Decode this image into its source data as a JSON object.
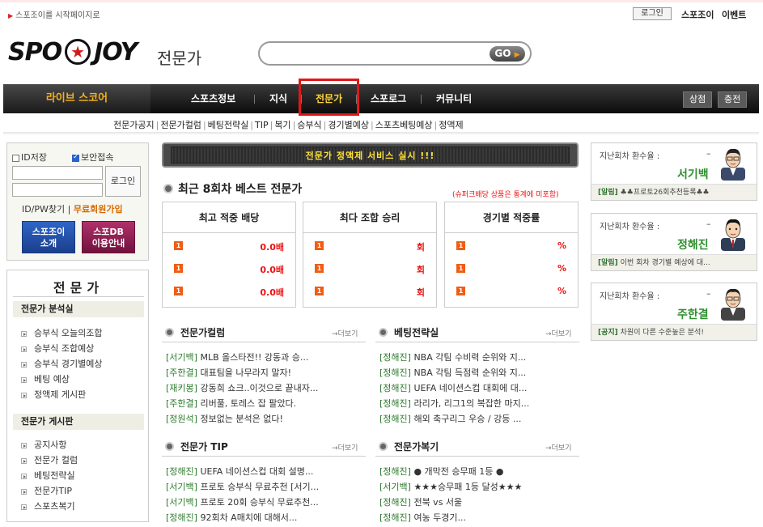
{
  "top": {
    "startpage": "스포조이를 시작페이지로",
    "login": "로그인",
    "spojoy": "스포조이",
    "event": "이벤트"
  },
  "logo": {
    "left": "SPO",
    "right": "JOY",
    "sub": "전문가"
  },
  "search": {
    "value": "",
    "go": "GO"
  },
  "nav": {
    "live": "라이브 스코어",
    "items": [
      "스포츠정보",
      "지식",
      "전문가",
      "스포로그",
      "커뮤니티"
    ],
    "shop": "상점",
    "charge": "충전"
  },
  "subnav": [
    "전문가공지",
    "전문가컬럼",
    "베팅전략실",
    "TIP",
    "복기",
    "승부식",
    "경기별예상",
    "스포츠베팅예상",
    "정액제"
  ],
  "login": {
    "save_id": "ID저장",
    "secure": "보안접속",
    "button": "로그인",
    "find": "ID/PW찾기",
    "register": "무료회원가입",
    "btn1": [
      "스포조이",
      "소개"
    ],
    "btn2": [
      "스포DB",
      "이용안내"
    ]
  },
  "leftmenu": {
    "title": "전문가",
    "sec1": "전문가 분석실",
    "items1": [
      "승부식 오늘의조합",
      "승부식 조합예상",
      "승부식 경기별예상",
      "베팅 예상",
      "정액제 게시판"
    ],
    "sec2": "전문가 게시판",
    "items2": [
      "공지사항",
      "전문가 컬럼",
      "베팅전략실",
      "전문가TIP",
      "스포츠복기"
    ]
  },
  "banner": "전문가 정액제 서비스 실시 !!!",
  "best": {
    "title": "최근 8회차 베스트 전문가",
    "note": "(슈퍼크배당 상품은 통계에 미포함)",
    "panels": [
      {
        "title": "최고 적중 배당",
        "rows": [
          "0.0배",
          "0.0배",
          "0.0배"
        ]
      },
      {
        "title": "최다 조합 승리",
        "rows": [
          "회",
          "회",
          "회"
        ]
      },
      {
        "title": "경기별 적중률",
        "rows": [
          "%",
          "%",
          "%"
        ]
      }
    ],
    "rank_label": "1"
  },
  "sections": {
    "more": "→더보기",
    "column": {
      "title": "전문가컬럼",
      "items": [
        {
          "tag": "[서기백]",
          "text": " MLB 올스타전!! 강동과 승..."
        },
        {
          "tag": "[주한결]",
          "text": " 대표팀을 나무라지 말자!"
        },
        {
          "tag": "[재키봉]",
          "text": " 강동희 쇼크..이것으로 끝내자..."
        },
        {
          "tag": "[주한결]",
          "text": " 리버풀, 토레스 잡 팔았다."
        },
        {
          "tag": "[정원석]",
          "text": " 정보없는 분석은 없다!"
        }
      ]
    },
    "strategy": {
      "title": "베팅전략실",
      "items": [
        {
          "tag": "[정해진]",
          "text": " NBA 각팀 수비력 순위와 지..."
        },
        {
          "tag": "[정해진]",
          "text": " NBA 각팀 득점력 순위와 지..."
        },
        {
          "tag": "[정해진]",
          "text": " UEFA 네이션스컵 대회에 대..."
        },
        {
          "tag": "[정해진]",
          "text": " 라리가, 리그1의 복잡한 마지..."
        },
        {
          "tag": "[정해진]",
          "text": " 해외 축구리그 우승 / 강등 ..."
        }
      ]
    },
    "tip": {
      "title": "전문가 TIP",
      "items": [
        {
          "tag": "[정해진]",
          "text": " UEFA 네이션스컵 대회 설명..."
        },
        {
          "tag": "[서기백]",
          "text": " 프로토 승부식 무료추천 [서기..."
        },
        {
          "tag": "[서기백]",
          "text": " 프로토 20회 승부식 무료추천..."
        },
        {
          "tag": "[정해진]",
          "text": " 92회차 A매치에 대해서..."
        }
      ]
    },
    "review": {
      "title": "전문가복기",
      "items": [
        {
          "tag": "[정해진]",
          "text": " ● 개막전 승무패 1등 ●"
        },
        {
          "tag": "[서기백]",
          "text": " ★★★승무패 1등 달성★★★"
        },
        {
          "tag": "[정해진]",
          "text": " 전북 vs 서울"
        },
        {
          "tag": "[정해진]",
          "text": " 여농 두경기..."
        }
      ]
    }
  },
  "experts": [
    {
      "label": "지난회차 환수율 :",
      "dash": "–",
      "name": "서기백",
      "tag": "[알림]",
      "msg": " ♣♣프로토26회추천등록♣♣"
    },
    {
      "label": "지난회차 환수율 :",
      "dash": "–",
      "name": "정해진",
      "tag": "[알림]",
      "msg": " 이번 회차 경기별 예상에 대..."
    },
    {
      "label": "지난회차 환수율 :",
      "dash": "–",
      "name": "주한결",
      "tag": "[공지]",
      "msg": " 차원이 다른 수준높은 분석!"
    }
  ],
  "colors": {
    "accent": "#e01818",
    "live": "#f5b01a",
    "green": "#2f8f2f",
    "rank": "#f05d14"
  }
}
